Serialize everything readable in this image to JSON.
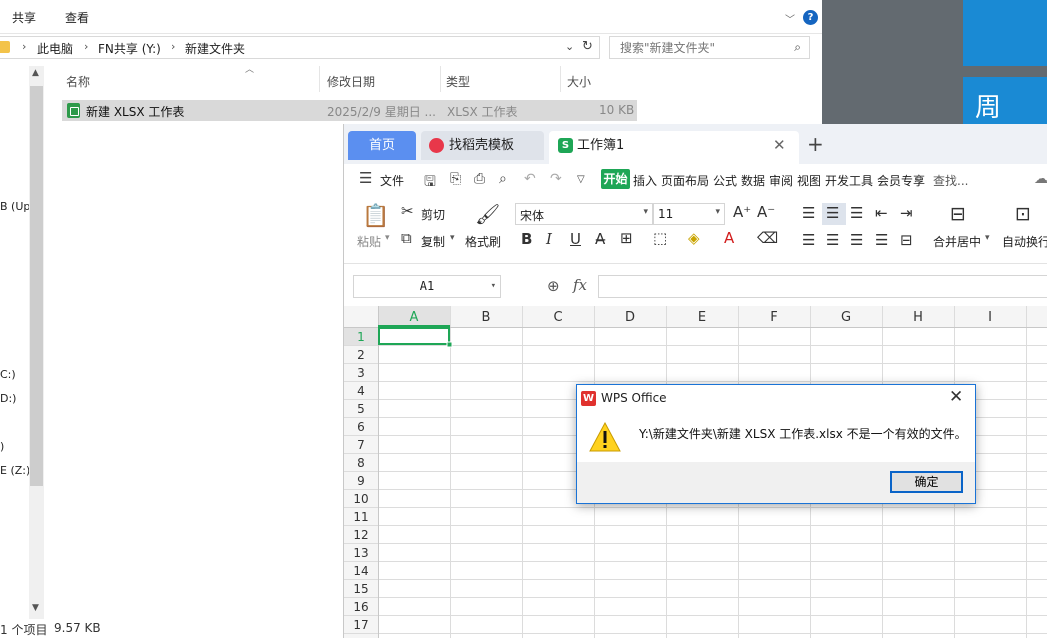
{
  "desktop": {
    "tile_text": "周"
  },
  "explorer": {
    "ribbon_tabs": [
      "共享",
      "查看"
    ],
    "breadcrumb": [
      "此电脑",
      "FN共享 (Y:)",
      "新建文件夹"
    ],
    "search_placeholder": "搜索\"新建文件夹\"",
    "nav_items": [
      "B (Up",
      "C:)",
      "D:)",
      ")",
      "E (Z:)"
    ],
    "columns": {
      "name": "名称",
      "modified": "修改日期",
      "type": "类型",
      "size": "大小"
    },
    "files": [
      {
        "name": "新建 XLSX 工作表",
        "modified": "2025/2/9 星期日 ...",
        "type": "XLSX 工作表",
        "size": "10 KB"
      }
    ],
    "status": {
      "count": "1 个项目",
      "size": "9.57 KB"
    }
  },
  "wps": {
    "tabs": {
      "home": "首页",
      "template": "找稻壳模板",
      "workbook": "工作簿1"
    },
    "menu": {
      "file": "文件",
      "start": "开始",
      "items": [
        "插入",
        "页面布局",
        "公式",
        "数据",
        "审阅",
        "视图",
        "开发工具",
        "会员专享"
      ],
      "search": "查找..."
    },
    "toolbar": {
      "paste": "粘贴",
      "cut": "剪切",
      "copy": "复制",
      "format_painter": "格式刷",
      "font_name": "宋体",
      "font_size": "11",
      "merge": "合并居中",
      "wrap": "自动换行"
    },
    "namebox": "A1",
    "columns": [
      "A",
      "B",
      "C",
      "D",
      "E",
      "F",
      "G",
      "H",
      "I"
    ],
    "rows": [
      "1",
      "2",
      "3",
      "4",
      "5",
      "6",
      "7",
      "8",
      "9",
      "10",
      "11",
      "12",
      "13",
      "14",
      "15",
      "16",
      "17"
    ],
    "selected_cell": "A1"
  },
  "dialog": {
    "title": "WPS Office",
    "message": "Y:\\新建文件夹\\新建 XLSX 工作表.xlsx 不是一个有效的文件。",
    "ok": "确定"
  }
}
